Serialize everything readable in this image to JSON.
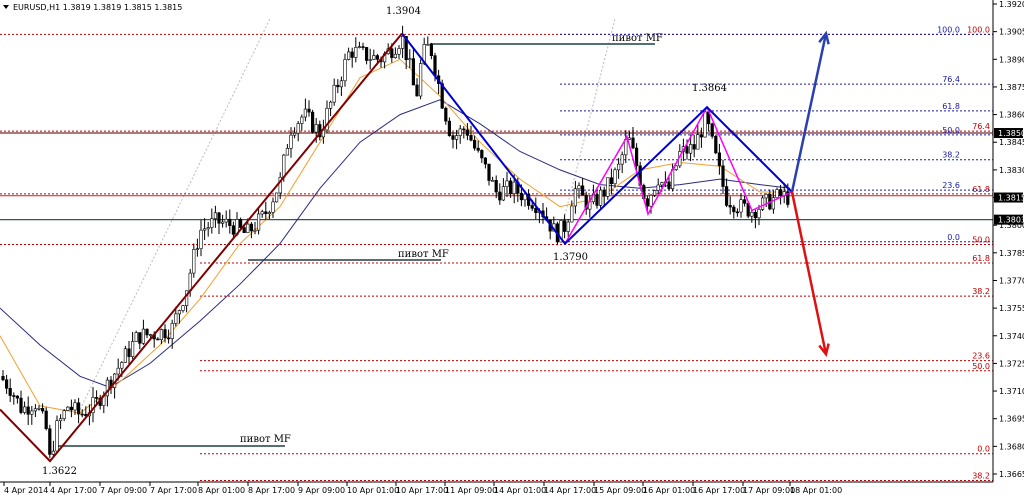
{
  "header": {
    "symbol_text": "EURUSD,H1  1.3819 1.3819 1.3815 1.3815"
  },
  "colors": {
    "bull_candle": "#000000",
    "bear_candle": "#000000",
    "ma_fast": "#f0a030",
    "ma_slow": "#2a2a80",
    "wave_up_early": "#800000",
    "wave_blue": "#0000cc",
    "pink": "#ff00ff",
    "arrow_up": "#2a3fb0",
    "arrow_down": "#dd1111",
    "level_red": "#c00000",
    "level_blue": "#1a1aa0",
    "pivot": "#1f4040"
  },
  "annotations": {
    "high1": "1.3904",
    "low1": "1.3622",
    "low2": "1.3790",
    "high2": "1.3864",
    "pivot_top": "пивот MF",
    "pivot_mid": "пивот MF",
    "pivot_low": "пивот MF"
  },
  "price_tags": [
    {
      "value": "1.3850",
      "price": 1.385
    },
    {
      "value": "1.3815",
      "price": 1.3815
    },
    {
      "value": "1.3803",
      "price": 1.3803
    }
  ],
  "fib_blue": [
    {
      "label": "100.0",
      "price": 1.39035
    },
    {
      "label": "76.4",
      "price": 1.38765
    },
    {
      "label": "61.8",
      "price": 1.3862
    },
    {
      "label": "50.0",
      "price": 1.3849
    },
    {
      "label": "38.2",
      "price": 1.38355
    },
    {
      "label": "23.6",
      "price": 1.3819
    },
    {
      "label": "0.0",
      "price": 1.3791
    }
  ],
  "fib_red": [
    {
      "label": "100.0",
      "price": 1.39035
    },
    {
      "label": "76.4",
      "price": 1.3851
    },
    {
      "label": "61.8",
      "price": 1.3817
    },
    {
      "label": "50.0",
      "price": 1.37895
    },
    {
      "label": "61.8",
      "price": 1.37795
    },
    {
      "label": "38.2",
      "price": 1.37615
    },
    {
      "label": "23.6",
      "price": 1.37265
    },
    {
      "label": "50.0",
      "price": 1.3721
    },
    {
      "label": "0.0",
      "price": 1.3676
    },
    {
      "label": "38.2",
      "price": 1.36615
    }
  ],
  "chart_data": {
    "type": "candlestick",
    "timeframe": "H1",
    "ylim": [
      1.366,
      1.392
    ],
    "y_ticks": [
      "1.3920",
      "1.3905",
      "1.3890",
      "1.3875",
      "1.3860",
      "1.3845",
      "1.3830",
      "1.3815",
      "1.3800",
      "1.3785",
      "1.3770",
      "1.3755",
      "1.3740",
      "1.3725",
      "1.3710",
      "1.3695",
      "1.3680",
      "1.3665"
    ],
    "x_labels": [
      "4 Apr 2014",
      "4 Apr 17:00",
      "7 Apr 09:00",
      "7 Apr 17:00",
      "8 Apr 01:00",
      "8 Apr 17:00",
      "9 Apr 09:00",
      "10 Apr 01:00",
      "10 Apr 17:00",
      "11 Apr 09:00",
      "14 Apr 01:00",
      "14 Apr 17:00",
      "15 Apr 09:00",
      "16 Apr 01:00",
      "16 Apr 17:00",
      "17 Apr 09:00",
      "18 Apr 01:00"
    ],
    "price_path": [
      [
        0,
        1.3718
      ],
      [
        10,
        1.3712
      ],
      [
        22,
        1.37
      ],
      [
        35,
        1.3704
      ],
      [
        46,
        1.369
      ],
      [
        50,
        1.3672
      ],
      [
        56,
        1.3689
      ],
      [
        68,
        1.3702
      ],
      [
        80,
        1.3697
      ],
      [
        96,
        1.3703
      ],
      [
        110,
        1.3716
      ],
      [
        122,
        1.3726
      ],
      [
        138,
        1.374
      ],
      [
        155,
        1.3741
      ],
      [
        172,
        1.3744
      ],
      [
        186,
        1.3765
      ],
      [
        200,
        1.3797
      ],
      [
        216,
        1.3802
      ],
      [
        232,
        1.38
      ],
      [
        246,
        1.3795
      ],
      [
        264,
        1.3805
      ],
      [
        280,
        1.3823
      ],
      [
        290,
        1.3852
      ],
      [
        304,
        1.386
      ],
      [
        320,
        1.385
      ],
      [
        334,
        1.3871
      ],
      [
        350,
        1.3895
      ],
      [
        366,
        1.3892
      ],
      [
        380,
        1.389
      ],
      [
        396,
        1.3898
      ],
      [
        402,
        1.3902
      ],
      [
        410,
        1.3885
      ],
      [
        416,
        1.3868
      ],
      [
        422,
        1.3892
      ],
      [
        430,
        1.3898
      ],
      [
        442,
        1.3868
      ],
      [
        452,
        1.3847
      ],
      [
        466,
        1.3853
      ],
      [
        476,
        1.384
      ],
      [
        486,
        1.383
      ],
      [
        496,
        1.3818
      ],
      [
        512,
        1.382
      ],
      [
        528,
        1.3815
      ],
      [
        540,
        1.381
      ],
      [
        556,
        1.3795
      ],
      [
        566,
        1.38
      ],
      [
        574,
        1.382
      ],
      [
        590,
        1.381
      ],
      [
        604,
        1.3818
      ],
      [
        618,
        1.383
      ],
      [
        628,
        1.3848
      ],
      [
        638,
        1.383
      ],
      [
        646,
        1.3812
      ],
      [
        658,
        1.3826
      ],
      [
        668,
        1.3818
      ],
      [
        680,
        1.3839
      ],
      [
        694,
        1.3842
      ],
      [
        706,
        1.3858
      ],
      [
        714,
        1.384
      ],
      [
        726,
        1.3815
      ],
      [
        740,
        1.381
      ],
      [
        752,
        1.3808
      ],
      [
        766,
        1.3812
      ],
      [
        780,
        1.3816
      ],
      [
        790,
        1.3815
      ]
    ],
    "ma_fast": [
      [
        0,
        1.374
      ],
      [
        40,
        1.3702
      ],
      [
        80,
        1.3698
      ],
      [
        120,
        1.3715
      ],
      [
        160,
        1.3735
      ],
      [
        200,
        1.376
      ],
      [
        240,
        1.379
      ],
      [
        280,
        1.381
      ],
      [
        320,
        1.3845
      ],
      [
        360,
        1.388
      ],
      [
        400,
        1.389
      ],
      [
        440,
        1.387
      ],
      [
        480,
        1.3845
      ],
      [
        520,
        1.3825
      ],
      [
        560,
        1.381
      ],
      [
        600,
        1.3815
      ],
      [
        640,
        1.383
      ],
      [
        680,
        1.3834
      ],
      [
        720,
        1.3832
      ],
      [
        760,
        1.3818
      ],
      [
        790,
        1.3818
      ]
    ],
    "ma_slow": [
      [
        0,
        1.3755
      ],
      [
        40,
        1.3735
      ],
      [
        80,
        1.3718
      ],
      [
        110,
        1.3712
      ],
      [
        150,
        1.3725
      ],
      [
        200,
        1.3748
      ],
      [
        240,
        1.3768
      ],
      [
        280,
        1.379
      ],
      [
        320,
        1.382
      ],
      [
        360,
        1.3845
      ],
      [
        400,
        1.386
      ],
      [
        440,
        1.3868
      ],
      [
        480,
        1.3855
      ],
      [
        520,
        1.384
      ],
      [
        560,
        1.383
      ],
      [
        600,
        1.3822
      ],
      [
        640,
        1.382
      ],
      [
        680,
        1.3822
      ],
      [
        720,
        1.3825
      ],
      [
        760,
        1.3822
      ],
      [
        790,
        1.382
      ]
    ],
    "wave_early": [
      [
        0,
        1.37
      ],
      [
        50,
        1.3672
      ],
      [
        402,
        1.3904
      ]
    ],
    "wave_blue": [
      [
        402,
        1.3904
      ],
      [
        565,
        1.379
      ],
      [
        707,
        1.3864
      ],
      [
        792,
        1.3818
      ]
    ],
    "wave_pink": [
      [
        565,
        1.379
      ],
      [
        627,
        1.3848
      ],
      [
        648,
        1.3806
      ],
      [
        707,
        1.3864
      ],
      [
        752,
        1.3808
      ],
      [
        792,
        1.3818
      ]
    ],
    "projection_up": [
      [
        792,
        1.3818
      ],
      [
        826,
        1.3904
      ]
    ],
    "projection_down": [
      [
        792,
        1.3818
      ],
      [
        826,
        1.373
      ]
    ]
  }
}
